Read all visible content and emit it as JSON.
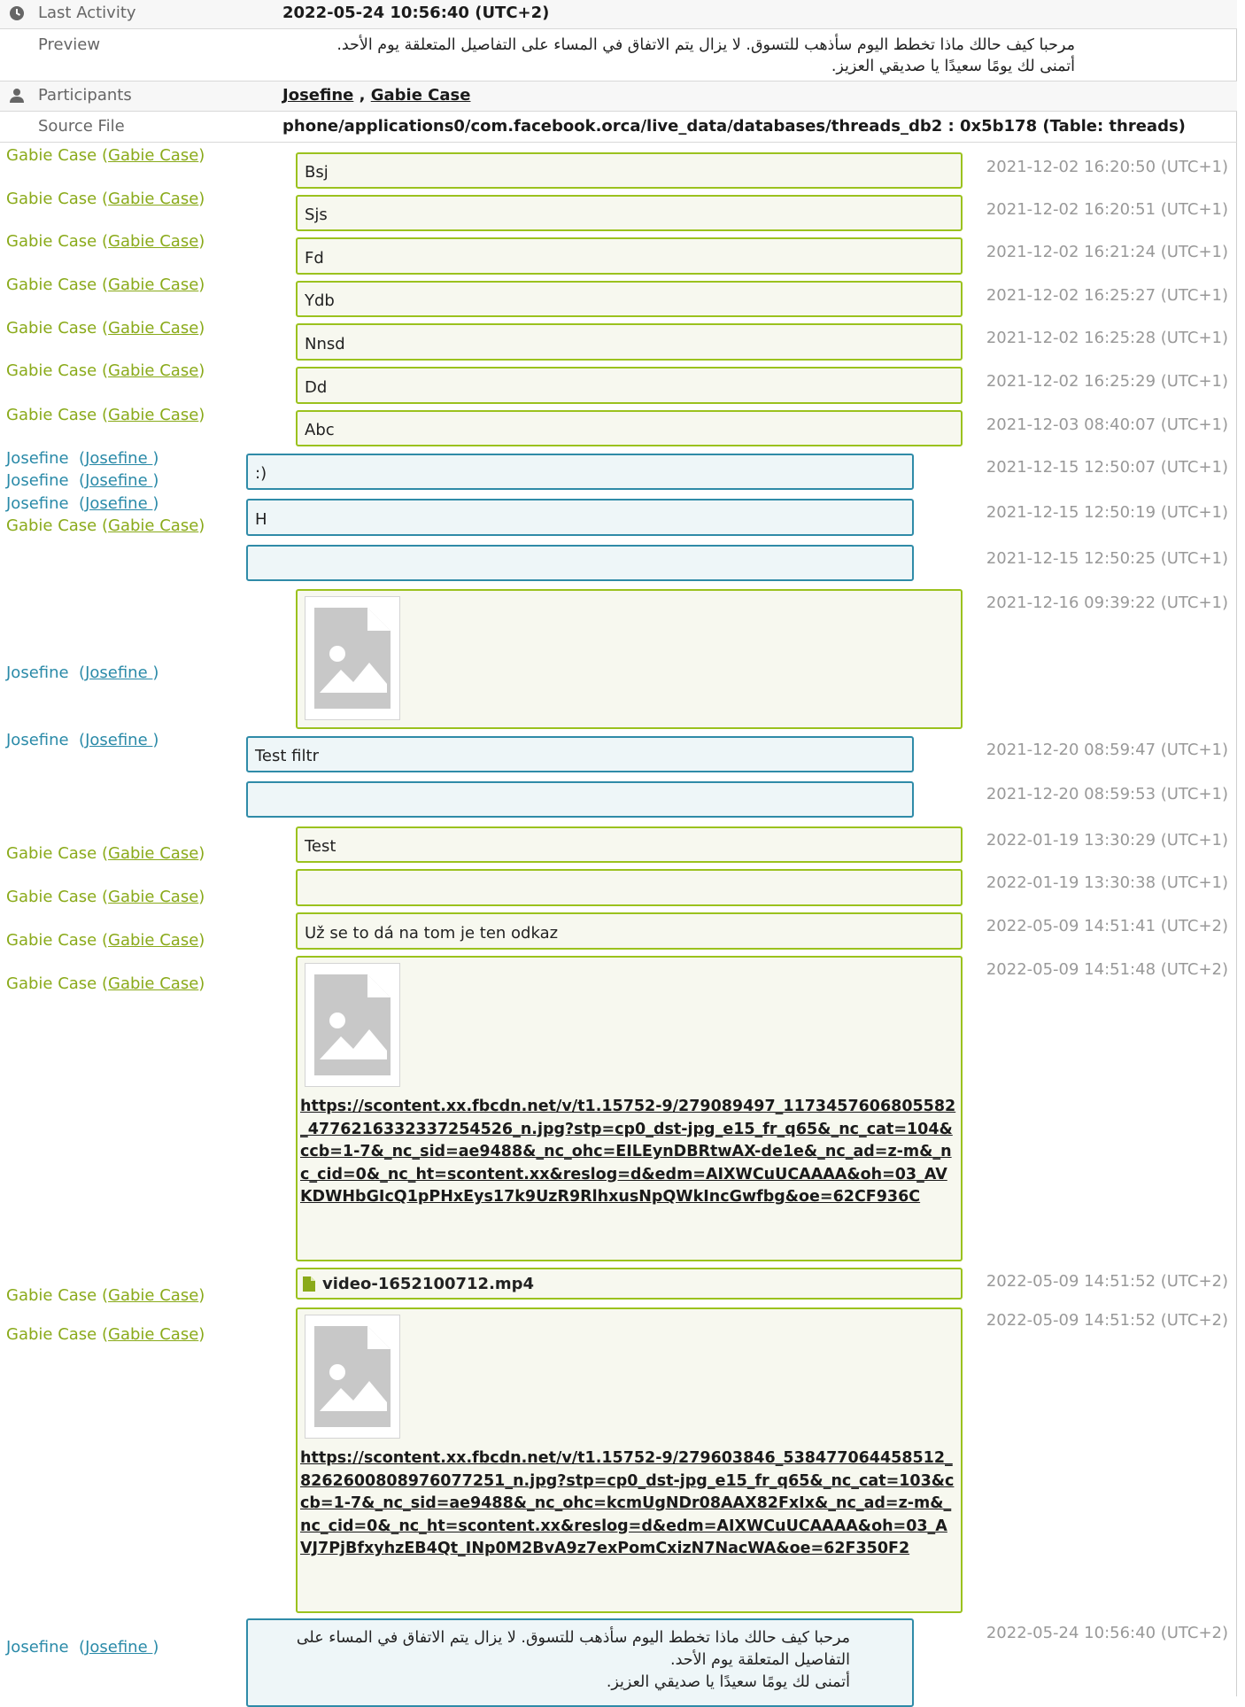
{
  "header": {
    "last_activity": {
      "label": "Last Activity",
      "value": "2022-05-24 10:56:40 (UTC+2)"
    },
    "preview": {
      "label": "Preview",
      "line1": "مرحبا كيف حالك ماذا تخطط اليوم سأذهب للتسوق. لا يزال يتم الاتفاق في المساء على التفاصيل المتعلقة يوم الأحد.",
      "line2": "أتمنى لك يومًا سعيدًا يا صديقي العزيز."
    },
    "participants": {
      "label": "Participants",
      "p1": "Josefine",
      "sep": " , ",
      "p2": "Gabie Case"
    },
    "source_file": {
      "label": "Source File",
      "value": "phone/applications0/com.facebook.orca/live_data/databases/threads_db2 : 0x5b178 (Table: threads)"
    }
  },
  "gabie": {
    "name": "Gabie Case",
    "open": " (",
    "handle": "Gabie Case",
    "close": ")"
  },
  "josefine": {
    "name": "Josefine",
    "open": "  (",
    "handle": "Josefine ",
    "close": ")"
  },
  "messages": [
    {
      "text": "Bsj",
      "time": "2021-12-02 16:20:50 (UTC+1)"
    },
    {
      "text": "Sjs",
      "time": "2021-12-02 16:20:51 (UTC+1)"
    },
    {
      "text": "Fd",
      "time": "2021-12-02 16:21:24 (UTC+1)"
    },
    {
      "text": "Ydb",
      "time": "2021-12-02 16:25:27 (UTC+1)"
    },
    {
      "text": "Nnsd",
      "time": "2021-12-02 16:25:28 (UTC+1)"
    },
    {
      "text": "Dd",
      "time": "2021-12-02 16:25:29 (UTC+1)"
    },
    {
      "text": "Abc",
      "time": "2021-12-03 08:40:07 (UTC+1)"
    },
    {
      "text": ":)",
      "time": "2021-12-15 12:50:07 (UTC+1)"
    },
    {
      "text": "H",
      "time": "2021-12-15 12:50:19 (UTC+1)"
    },
    {
      "text": "",
      "time": "2021-12-15 12:50:25 (UTC+1)"
    },
    {
      "text": "",
      "time": "2021-12-16 09:39:22 (UTC+1)"
    },
    {
      "text": "Test filtr",
      "time": "2021-12-20 08:59:47 (UTC+1)"
    },
    {
      "text": "",
      "time": "2021-12-20 08:59:53 (UTC+1)"
    },
    {
      "text": "Test",
      "time": "2022-01-19 13:30:29 (UTC+1)"
    },
    {
      "text": "",
      "time": "2022-01-19 13:30:38 (UTC+1)"
    },
    {
      "text": "Už se to dá na tom je ten odkaz",
      "time": "2022-05-09 14:51:41 (UTC+2)"
    },
    {
      "text": "",
      "time": "2022-05-09 14:51:48 (UTC+2)",
      "link": "https://scontent.xx.fbcdn.net/v/t1.15752-9/279089497_1173457606805582_4776216332337254526_n.jpg?stp=cp0_dst-jpg_e15_fr_q65&_nc_cat=104&ccb=1-7&_nc_sid=ae9488&_nc_ohc=EILEynDBRtwAX-de1e&_nc_ad=z-m&_nc_cid=0&_nc_ht=scontent.xx&reslog=d&edm=AIXWCuUCAAAA&oh=03_AVKDWHbGIcQ1pPHxEys17k9UzR9RlhxusNpQWkIncGwfbg&oe=62CF936C"
    },
    {
      "text": "video-1652100712.mp4",
      "time": "2022-05-09 14:51:52 (UTC+2)"
    },
    {
      "text": "",
      "time": "2022-05-09 14:51:52 (UTC+2)",
      "link": "https://scontent.xx.fbcdn.net/v/t1.15752-9/279603846_538477064458512_8262600808976077251_n.jpg?stp=cp0_dst-jpg_e15_fr_q65&_nc_cat=103&ccb=1-7&_nc_sid=ae9488&_nc_ohc=kcmUgNDr08AAX82FxIx&_nc_ad=z-m&_nc_cid=0&_nc_ht=scontent.xx&reslog=d&edm=AIXWCuUCAAAA&oh=03_AVJ7PjBfxyhzEB4Qt_INp0M2BvA9z7exPomCxizN7NacWA&oe=62F350F2"
    },
    {
      "text": "",
      "time": "2022-05-24 10:56:40 (UTC+2)",
      "line1": "مرحبا كيف حالك ماذا تخطط اليوم سأذهب للتسوق. لا يزال يتم الاتفاق في المساء على",
      "line2": "التفاصيل المتعلقة يوم الأحد.",
      "line3": "أتمنى لك يومًا سعيدًا يا صديقي العزيز."
    }
  ],
  "icons": {
    "clock": "clock-icon",
    "person": "person-icon",
    "image": "image-placeholder-icon",
    "file": "file-icon"
  },
  "colors": {
    "gabie": "#8aaa1a",
    "josefine": "#2a8aa8",
    "gabie_bubble": "#9bc21e",
    "josefine_bubble": "#2f8ba8"
  }
}
